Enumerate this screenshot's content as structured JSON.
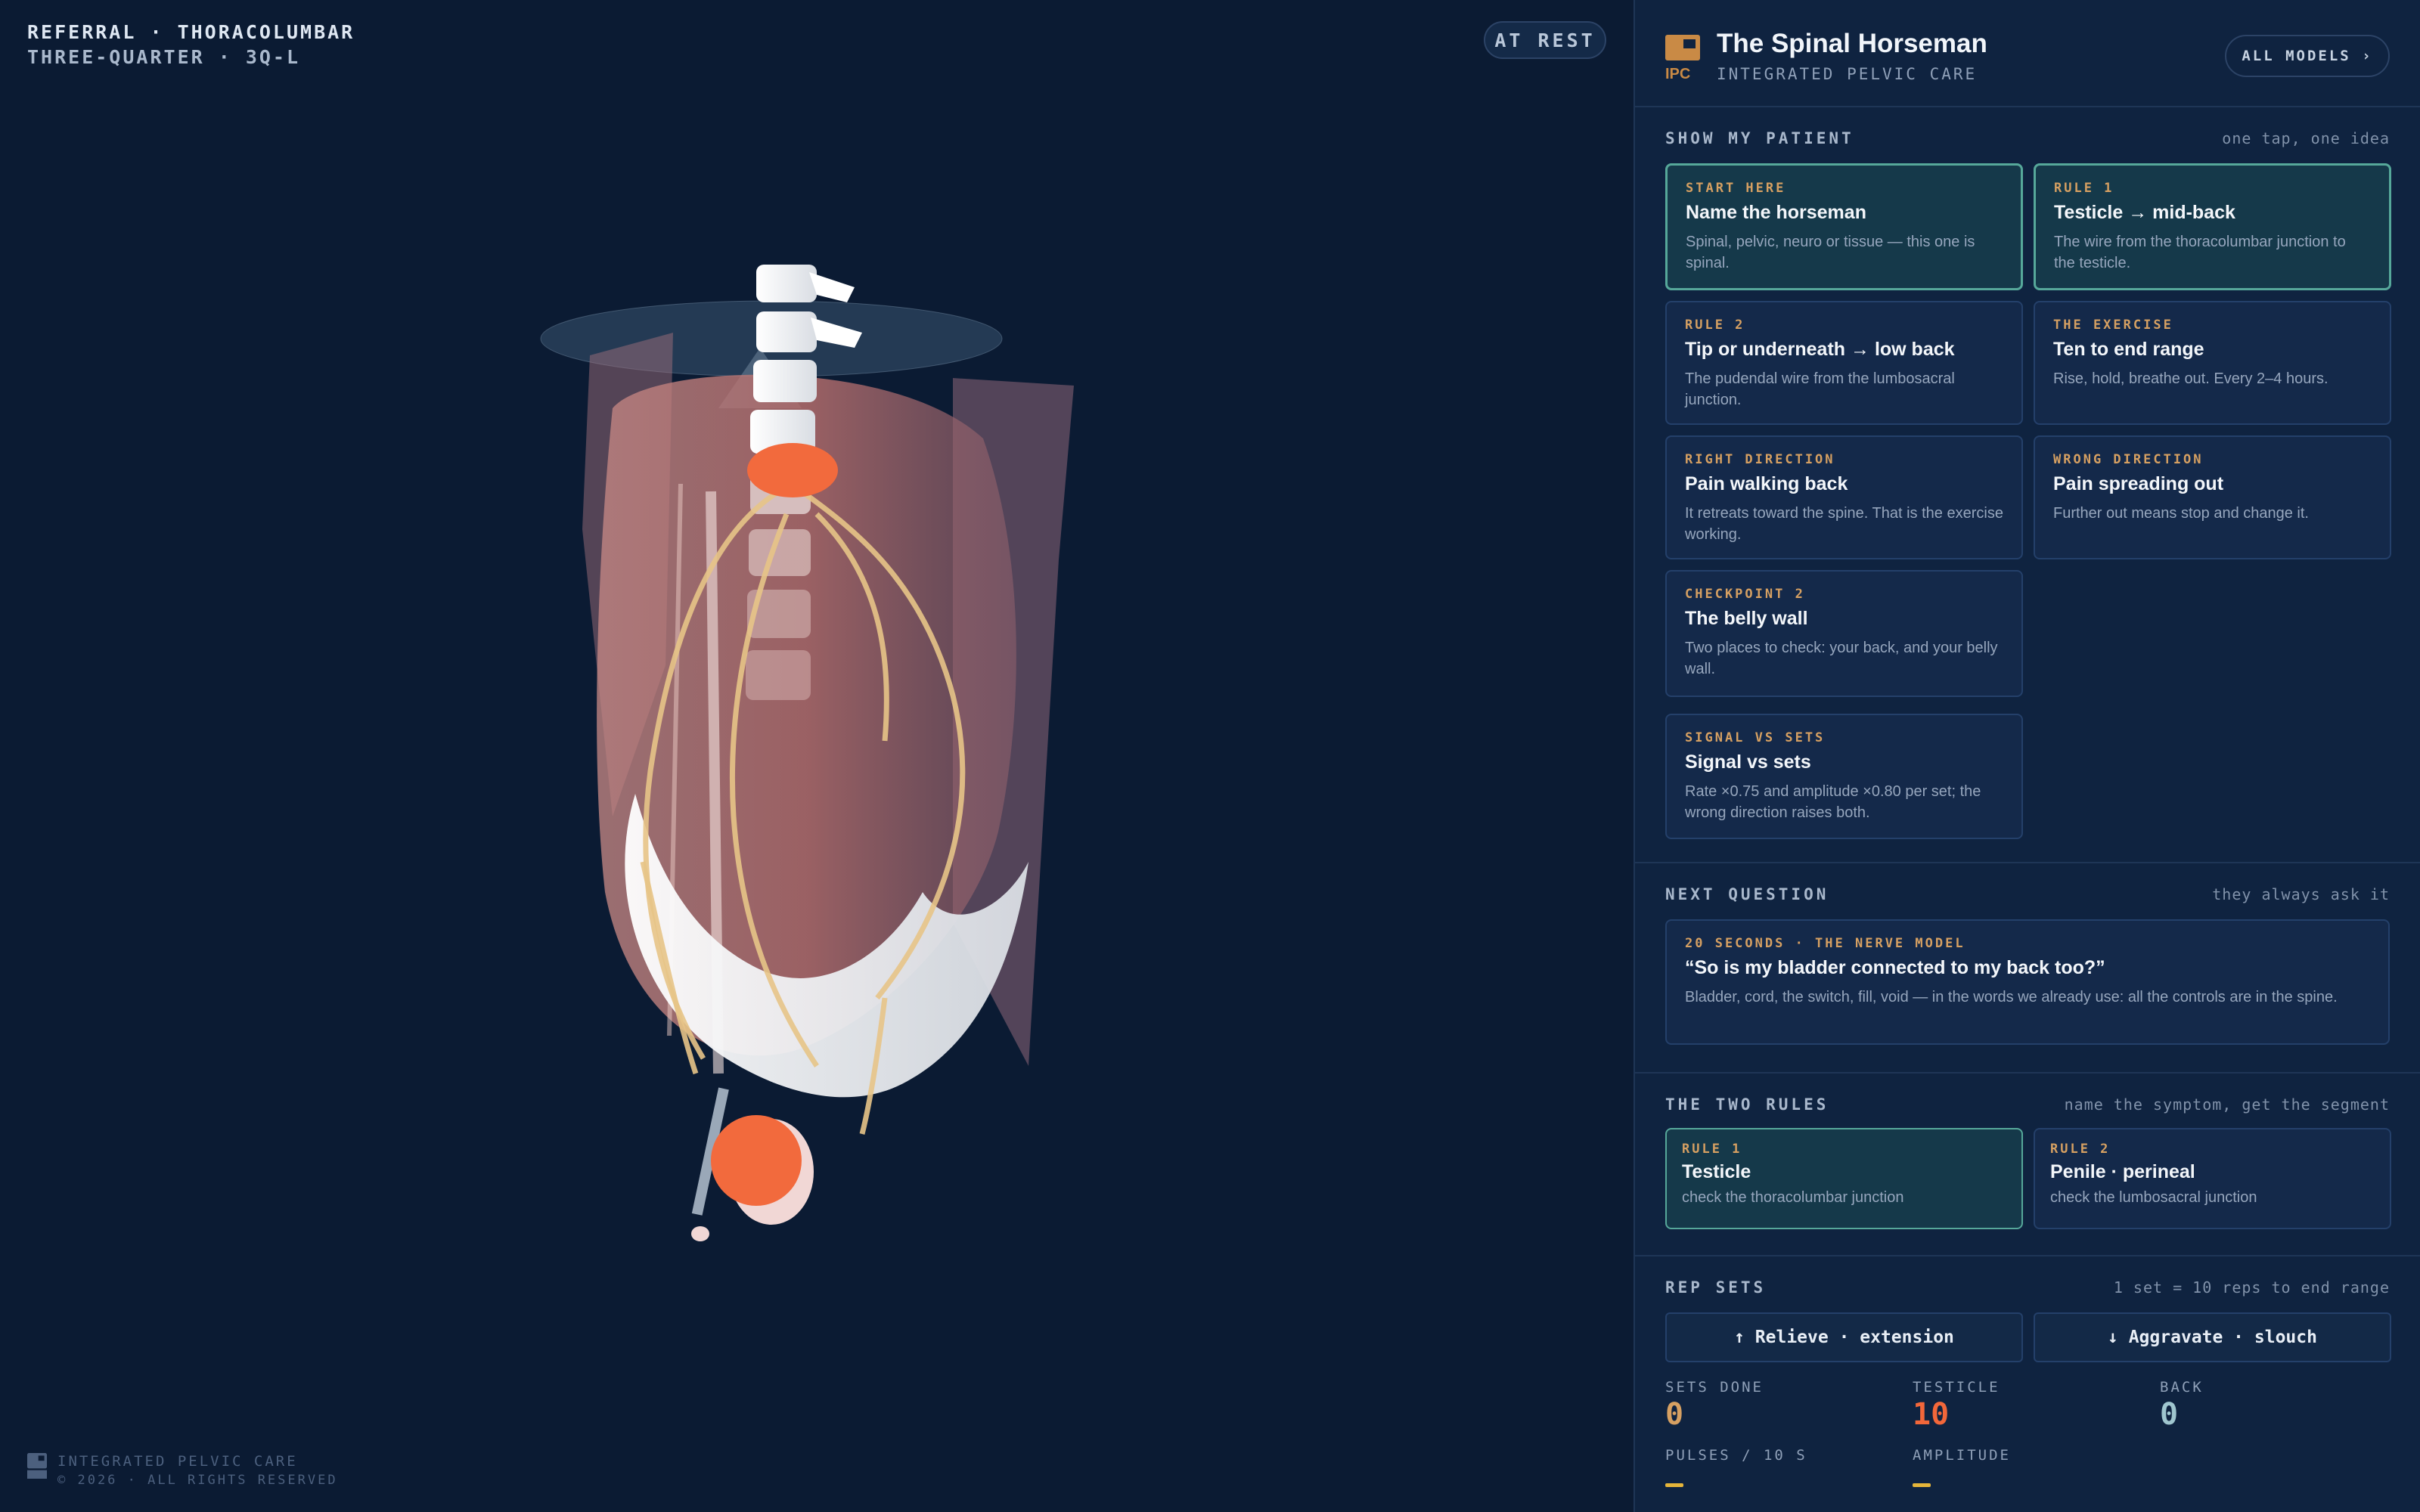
{
  "viewport": {
    "label_line1": "REFERRAL · THORACOLUMBAR",
    "label_line2": "THREE-QUARTER · 3Q-L",
    "state": "AT REST",
    "footer_line1": "INTEGRATED PELVIC CARE",
    "footer_line2": "© 2026 · ALL RIGHTS RESERVED",
    "model_icon": "anatomy-3d-model",
    "highlight_color": "#f26a3d"
  },
  "header": {
    "logo_text": "IPC",
    "title": "The Spinal Horseman",
    "subtitle": "INTEGRATED PELVIC CARE",
    "all_models": "ALL MODELS ›"
  },
  "show_patient": {
    "title": "SHOW MY PATIENT",
    "note": "one tap, one idea",
    "cards": [
      {
        "kicker": "START HERE",
        "title": "Name the horseman",
        "body": "Spinal, pelvic, neuro or tissue — this one is spinal."
      },
      {
        "kicker": "RULE 1",
        "title": "Testicle → mid-back",
        "body": "The wire from the thoracolumbar junction to the testicle."
      },
      {
        "kicker": "RULE 2",
        "title": "Tip or underneath → low back",
        "body": "The pudendal wire from the lumbosacral junction."
      },
      {
        "kicker": "THE EXERCISE",
        "title": "Ten to end range",
        "body": "Rise, hold, breathe out. Every 2–4 hours."
      },
      {
        "kicker": "RIGHT DIRECTION",
        "title": "Pain walking back",
        "body": "It retreats toward the spine. That is the exercise working."
      },
      {
        "kicker": "WRONG DIRECTION",
        "title": "Pain spreading out",
        "body": "Further out means stop and change it."
      },
      {
        "kicker": "CHECKPOINT 2",
        "title": "The belly wall",
        "body": "Two places to check: your back, and your belly wall."
      },
      {
        "kicker": "SIGNAL VS SETS",
        "title": "Signal vs sets",
        "body": "Rate ×0.75 and amplitude ×0.80 per set; the wrong direction raises both."
      }
    ]
  },
  "next_question": {
    "title": "NEXT QUESTION",
    "note": "they always ask it",
    "kicker": "20 SECONDS · THE NERVE MODEL",
    "question": "“So is my bladder connected to my back too?”",
    "body": "Bladder, cord, the switch, fill, void — in the words we already use: all the controls are in the spine."
  },
  "two_rules": {
    "title": "THE TWO RULES",
    "note": "name the symptom, get the segment",
    "rules": [
      {
        "kicker": "RULE 1",
        "title": "Testicle",
        "body": "check the thoracolumbar junction"
      },
      {
        "kicker": "RULE 2",
        "title": "Penile · perineal",
        "body": "check the lumbosacral junction"
      }
    ]
  },
  "rep_sets": {
    "title": "REP SETS",
    "note": "1 set = 10 reps to end range",
    "relieve": "↑ Relieve · extension",
    "aggravate": "↓ Aggravate · slouch",
    "stats": {
      "sets_done_label": "SETS DONE",
      "sets_done": "0",
      "testicle_label": "TESTICLE",
      "testicle": "10",
      "back_label": "BACK",
      "back": "0",
      "pulses_label": "PULSES / 10 S",
      "amplitude_label": "AMPLITUDE"
    },
    "colors": {
      "sets": "#d6a062",
      "testicle": "#f2673a",
      "back": "#9fc6cf",
      "dash": "#e5b53a"
    }
  }
}
